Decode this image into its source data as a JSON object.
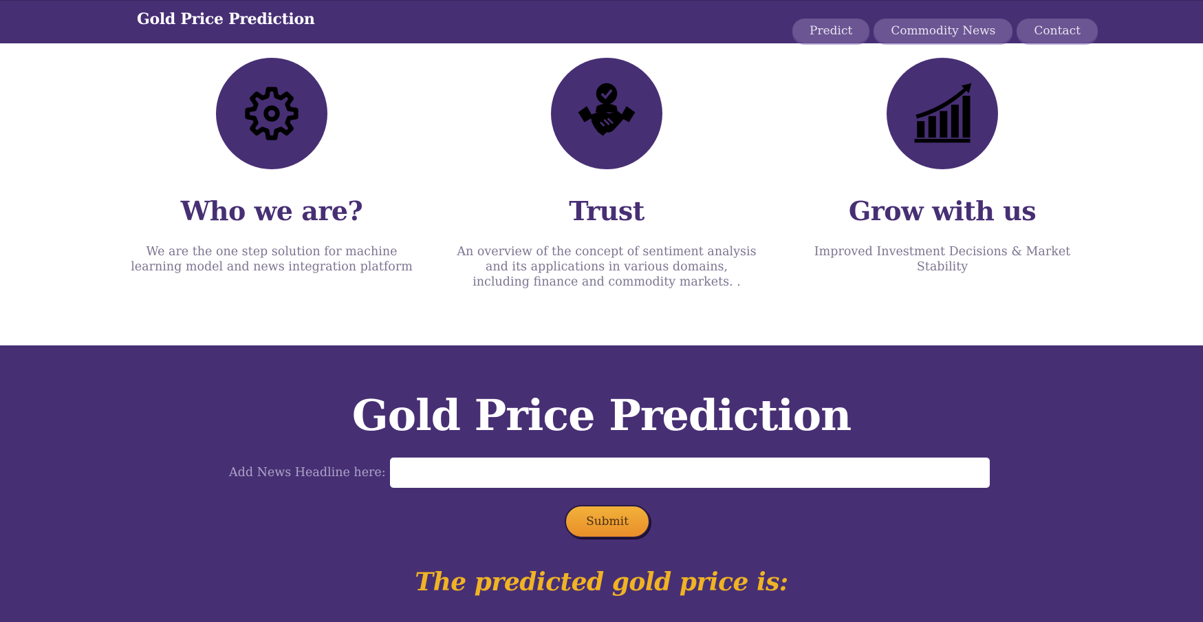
{
  "navbar": {
    "brand": "Gold Price Prediction",
    "links": [
      "Predict",
      "Commodity News",
      "Contact"
    ]
  },
  "features": [
    {
      "icon": "gear-icon",
      "title": "Who we are?",
      "text": "We are the one step solution for machine learning model and news integration platform"
    },
    {
      "icon": "handshake-icon",
      "title": "Trust",
      "text": "An overview of the concept of sentiment analysis and its applications in various domains, including finance and commodity markets. ."
    },
    {
      "icon": "growth-chart-icon",
      "title": "Grow with us",
      "text": "Improved Investment Decisions & Market Stability"
    }
  ],
  "predict": {
    "title": "Gold Price Prediction",
    "input_label": "Add News Headline here:",
    "input_value": "",
    "submit_label": "Submit",
    "result_text": "The predicted gold price is:"
  },
  "colors": {
    "brand_purple": "#472f74",
    "accent_gold": "#f0b323",
    "button_orange": "#ec9a2e"
  }
}
